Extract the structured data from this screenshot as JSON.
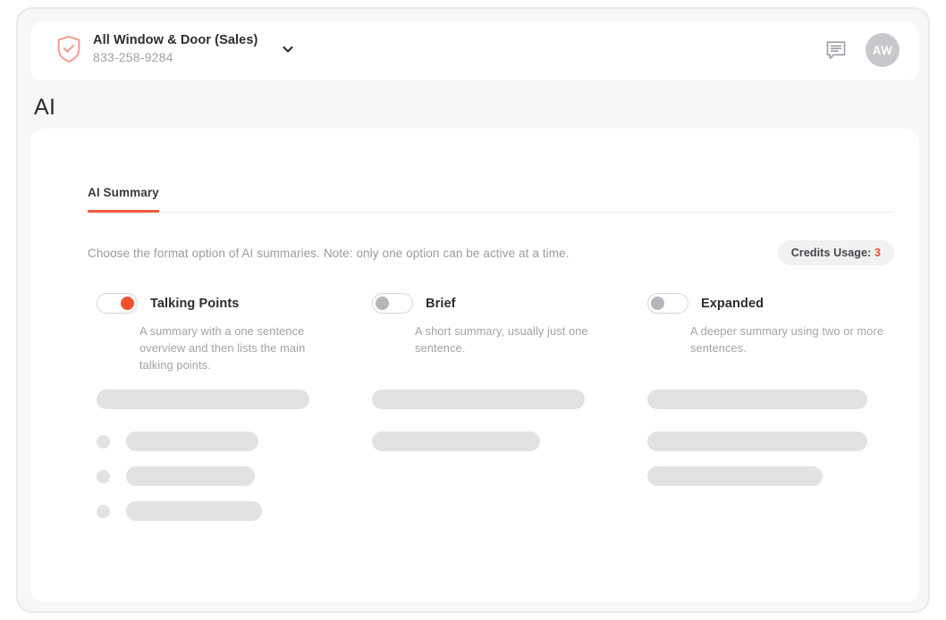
{
  "topbar": {
    "account": {
      "icon": "shield-check-icon",
      "name": "All Window & Door (Sales)",
      "phone": "833-258-9284",
      "dropdown_icon": "chevron-down-icon"
    },
    "chat_icon": "chat-message-icon",
    "avatar_initials": "AW"
  },
  "page_title": "AI",
  "card": {
    "tabs": [
      {
        "label": "AI Summary",
        "active": true
      }
    ],
    "description": "Choose the format option of AI summaries. Note: only one option can be active at a time.",
    "credits": {
      "label": "Credits Usage:",
      "value": "3"
    },
    "options": [
      {
        "label": "Talking Points",
        "description": "A summary with a one sentence overview and then lists the main talking points.",
        "enabled": true,
        "toggle_state": "on"
      },
      {
        "label": "Brief",
        "description": "A short summary, usually just one sentence.",
        "enabled": false,
        "toggle_state": "off"
      },
      {
        "label": "Expanded",
        "description": "A deeper summary using two or more sentences.",
        "enabled": false,
        "toggle_state": "off"
      }
    ]
  },
  "colors": {
    "accent": "#f3522e",
    "accent_light": "#f0a091",
    "text_primary": "#2c2c31",
    "text_muted": "#a0a0a8",
    "skeleton": "#e2e2e3",
    "page_bg": "#f7f7f8",
    "card_bg": "#ffffff",
    "avatar_bg": "#c8c8cc"
  }
}
